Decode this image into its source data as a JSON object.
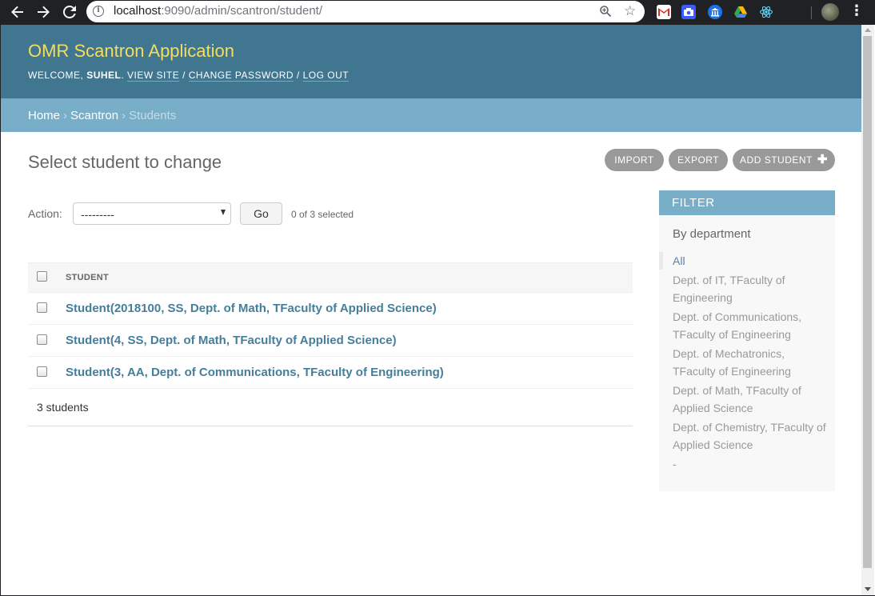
{
  "browser": {
    "url_host": "localhost",
    "url_rest": ":9090/admin/scantron/student/"
  },
  "header": {
    "branding": "OMR Scantron Application",
    "welcome": "Welcome,",
    "username": "Suhel",
    "view_site": "View site",
    "change_password": "Change password",
    "log_out": "Log out",
    "separator": "/"
  },
  "breadcrumbs": {
    "home": "Home",
    "app": "Scantron",
    "current": "Students",
    "separator": "›"
  },
  "page": {
    "title": "Select student to change"
  },
  "object_tools": {
    "import": "Import",
    "export": "Export",
    "add": "Add student"
  },
  "actions": {
    "label": "Action:",
    "selected_value": "---------",
    "go": "Go",
    "counter": "0 of 3 selected"
  },
  "results": {
    "column_header": "Student",
    "rows": [
      "Student(2018100, SS, Dept. of Math, TFaculty of Applied Science)",
      "Student(4, SS, Dept. of Math, TFaculty of Applied Science)",
      "Student(3, AA, Dept. of Communications, TFaculty of Engineering)"
    ],
    "count": "3 students"
  },
  "filter": {
    "title": "Filter",
    "subtitle": "By department",
    "items": [
      "All",
      "Dept. of IT, TFaculty of Engineering",
      "Dept. of Communications, TFaculty of Engineering",
      "Dept. of Mechatronics, TFaculty of Engineering",
      "Dept. of Math, TFaculty of Applied Science",
      "Dept. of Chemistry, TFaculty of Applied Science",
      "-"
    ]
  }
}
